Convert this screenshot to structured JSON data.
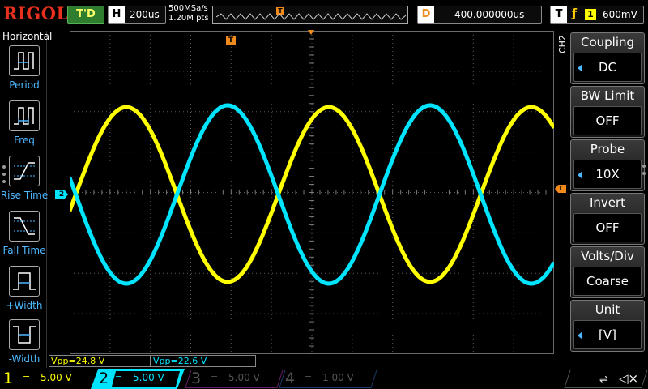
{
  "top_bar": {
    "logo": "RIGOL",
    "run_status": "T'D",
    "horizontal_key": "H",
    "timebase": "200us",
    "sample_rate": "500MSa/s",
    "memory_depth": "1.20M pts",
    "memory_trigger_marker": "T",
    "delay_key": "D",
    "delay_value": "400.000000us",
    "trigger_key": "T",
    "trigger_edge": "ƒ",
    "trigger_source": "1",
    "trigger_level": "600mV"
  },
  "left_panel": {
    "title": "Horizontal",
    "items": [
      {
        "label": "Period",
        "icon": "period-icon"
      },
      {
        "label": "Freq",
        "icon": "freq-icon"
      },
      {
        "label": "Rise Time",
        "icon": "rise-time-icon"
      },
      {
        "label": "Fall Time",
        "icon": "fall-time-icon"
      },
      {
        "label": "+Width",
        "icon": "positive-width-icon"
      },
      {
        "label": "-Width",
        "icon": "negative-width-icon"
      }
    ]
  },
  "grid": {
    "trigger_position_marker": "T",
    "ch2_ground_marker": "2",
    "trigger_level_marker": "T"
  },
  "waveforms": {
    "ch1_color": "#ffff00",
    "ch2_color": "#00e5ff",
    "ch1_phase": "inverted",
    "ch2_phase": "normal"
  },
  "right_menu": {
    "channel_tag": "CH2",
    "items": [
      {
        "title": "Coupling",
        "value": "DC",
        "has_arrow": true
      },
      {
        "title": "BW Limit",
        "value": "OFF",
        "has_arrow": false
      },
      {
        "title": "Probe",
        "value": "10X",
        "has_arrow": true
      },
      {
        "title": "Invert",
        "value": "OFF",
        "has_arrow": false
      },
      {
        "title": "Volts/Div",
        "value": "Coarse",
        "has_arrow": false
      },
      {
        "title": "Unit",
        "value": "[V]",
        "has_arrow": true
      }
    ]
  },
  "measurements": {
    "ch1_vpp": "Vpp=24.8 V",
    "ch2_vpp": "Vpp=22.6 V"
  },
  "bottom_bar": {
    "channels": [
      {
        "num": "1",
        "coupling": "=",
        "scale": "5.00 V",
        "color": "#ffff00",
        "active": true
      },
      {
        "num": "2",
        "coupling": "=",
        "scale": "5.00 V",
        "color": "#00e5ff",
        "active": true,
        "selected": true
      },
      {
        "num": "3",
        "coupling": "=",
        "scale": "5.00 V",
        "color": "#c040c0",
        "active": false
      },
      {
        "num": "4",
        "coupling": "=",
        "scale": "1.00 V",
        "color": "#4080ff",
        "active": false
      }
    ],
    "usb_icon": "usb-icon",
    "speaker_icon": "speaker-muted-icon"
  }
}
